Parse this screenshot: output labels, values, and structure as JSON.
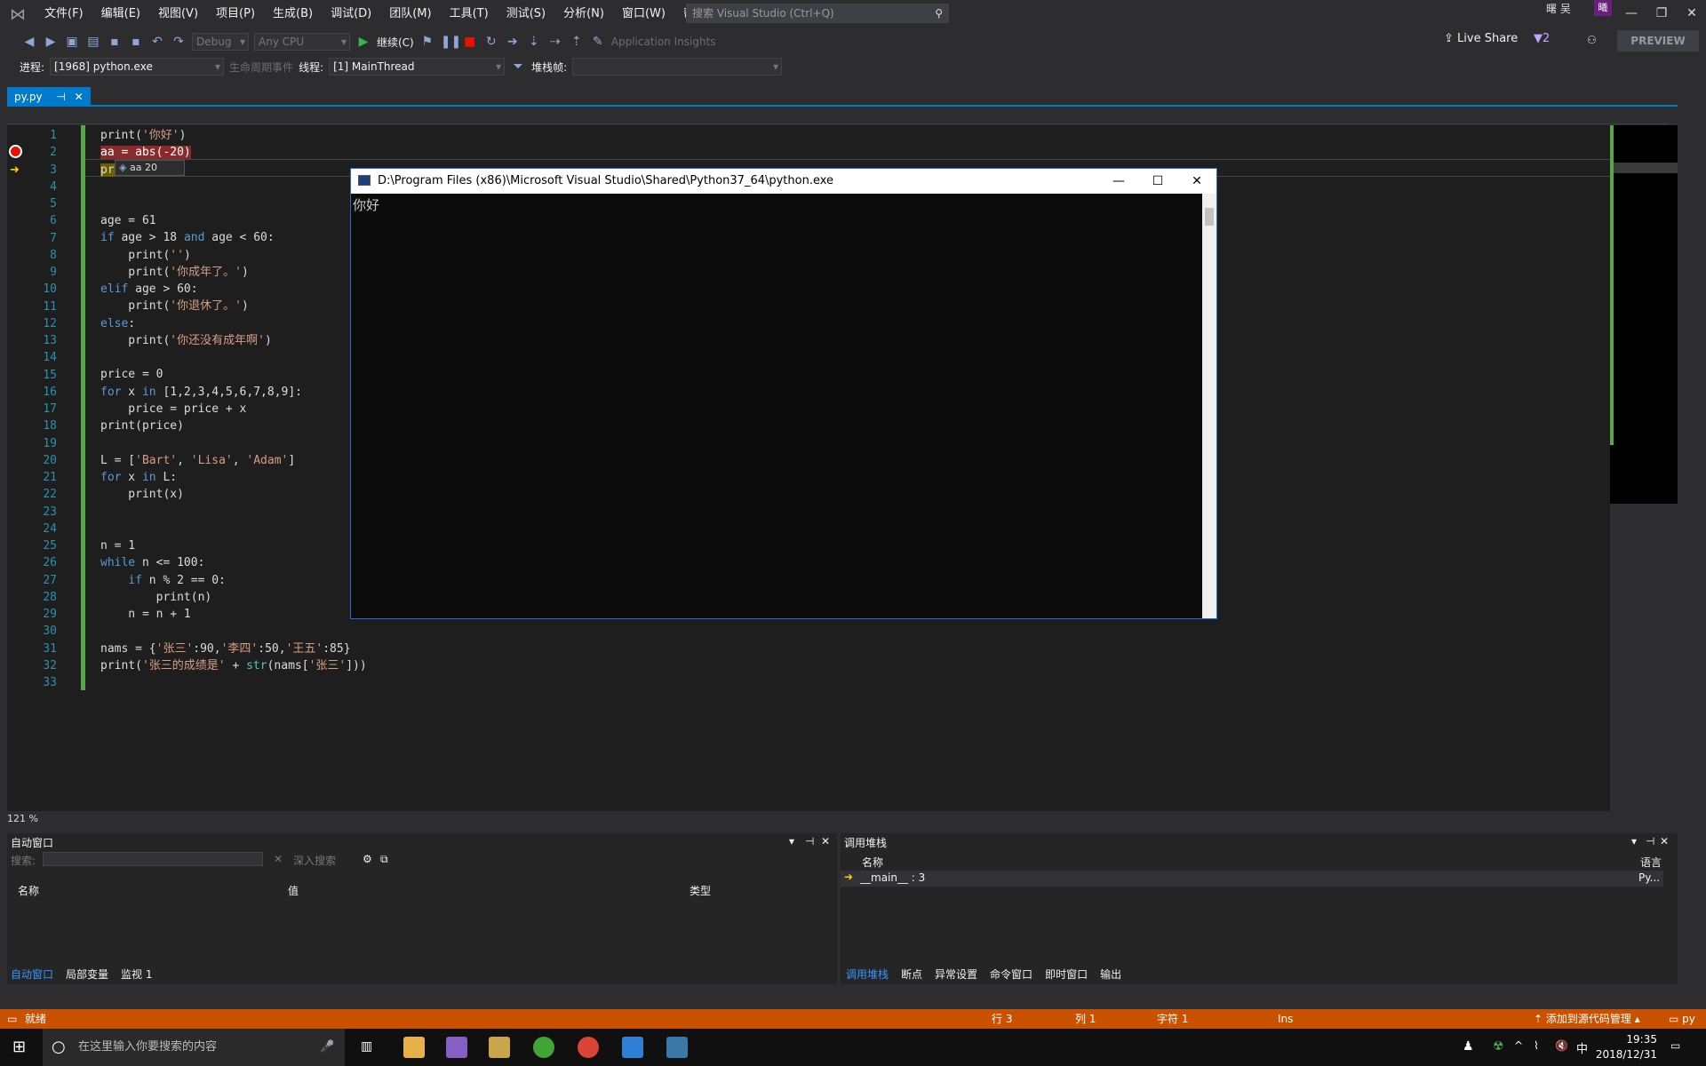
{
  "menu": [
    "文件(F)",
    "编辑(E)",
    "视图(V)",
    "项目(P)",
    "生成(B)",
    "调试(D)",
    "团队(M)",
    "工具(T)",
    "测试(S)",
    "分析(N)",
    "窗口(W)",
    "帮助(H)"
  ],
  "search_placeholder": "搜索 Visual Studio (Ctrl+Q)",
  "user_name": "曙 吴",
  "user_initial": "曦",
  "toolbar": {
    "config": "Debug",
    "platform": "Any CPU",
    "continue_label": "继续(C)",
    "app_insights": "Application Insights",
    "live_share": "Live Share",
    "filter_count": "2",
    "preview": "PREVIEW"
  },
  "debugbar": {
    "process_label": "进程:",
    "process_value": "[1968] python.exe",
    "lifecycle_label": "生命周期事件",
    "thread_label": "线程:",
    "thread_value": "[1] MainThread",
    "stackframe_label": "堆栈帧:"
  },
  "doc_tab": "py.py",
  "editor": {
    "line_numbers": [
      "1",
      "2",
      "3",
      "4",
      "5",
      "6",
      "7",
      "8",
      "9",
      "10",
      "11",
      "12",
      "13",
      "14",
      "15",
      "16",
      "17",
      "18",
      "19",
      "20",
      "21",
      "22",
      "23",
      "24",
      "25",
      "26",
      "27",
      "28",
      "29",
      "30",
      "31",
      "32",
      "33"
    ],
    "datatip": "aa  20",
    "zoom": "121 %"
  },
  "console": {
    "title": "D:\\Program Files (x86)\\Microsoft Visual Studio\\Shared\\Python37_64\\python.exe",
    "output": "你好"
  },
  "auto_panel": {
    "title": "自动窗口",
    "search_label": "搜索:",
    "deep_search": "深入搜索",
    "col_name": "名称",
    "col_value": "值",
    "col_type": "类型",
    "tabs": [
      "自动窗口",
      "局部变量",
      "监视 1"
    ]
  },
  "call_panel": {
    "title": "调用堆栈",
    "col_name": "名称",
    "col_lang": "语言",
    "row_name": "__main__ : 3",
    "row_lang": "Py...",
    "tabs": [
      "调用堆栈",
      "断点",
      "异常设置",
      "命令窗口",
      "即时窗口",
      "输出"
    ]
  },
  "status": {
    "ready": "就绪",
    "row": "行 3",
    "col": "列 1",
    "char": "字符 1",
    "ins": "Ins",
    "source_control": "添加到源代码管理",
    "project": "py"
  },
  "taskbar": {
    "search": "在这里输入你要搜索的内容",
    "time": "19:35",
    "date": "2018/12/31",
    "ime": "中"
  },
  "colors": {
    "accent": "#007acc",
    "status": "#ca5100",
    "breakpoint": "#e51400"
  }
}
